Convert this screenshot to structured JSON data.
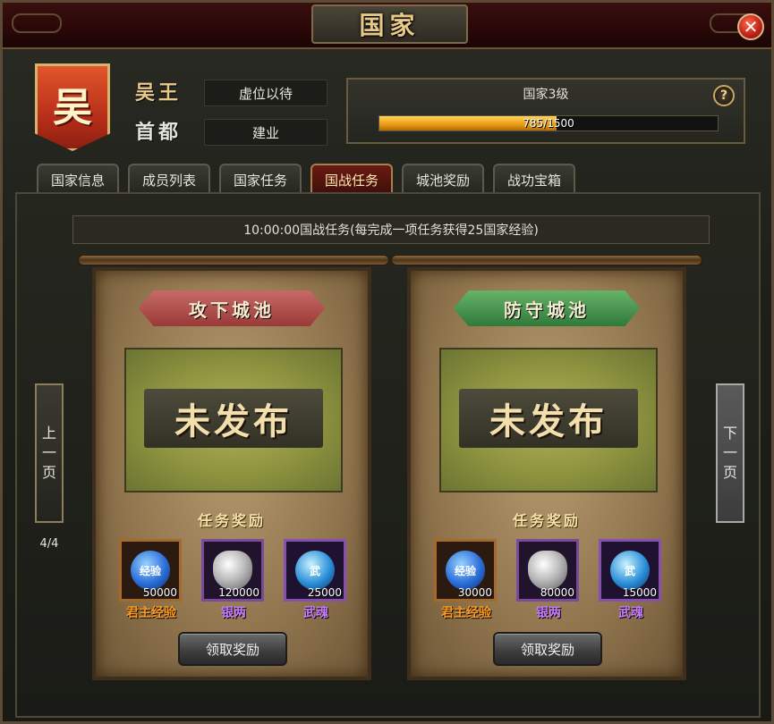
{
  "window": {
    "title": "国家",
    "close_symbol": "✕"
  },
  "header": {
    "banner_char": "吴",
    "rank_label": "吴王",
    "rank_value": "虚位以待",
    "capital_label": "首都",
    "capital_value": "建业",
    "level_text": "国家3级",
    "help_symbol": "?",
    "progress_text": "785/1500",
    "progress_fraction": 0.523
  },
  "tabs": [
    {
      "label": "国家信息",
      "active": false
    },
    {
      "label": "成员列表",
      "active": false
    },
    {
      "label": "国家任务",
      "active": false
    },
    {
      "label": "国战任务",
      "active": true
    },
    {
      "label": "城池奖励",
      "active": false
    },
    {
      "label": "战功宝箱",
      "active": false
    }
  ],
  "notice": "10:00:00国战任务(每完成一项任务获得25国家经验)",
  "pagination": {
    "prev_label": [
      "上",
      "一",
      "页"
    ],
    "next_label": [
      "下",
      "一",
      "页"
    ],
    "counter": "4/4"
  },
  "cards": [
    {
      "title": "攻下城池",
      "title_color": "red",
      "status": "未发布",
      "reward_title": "任务奖励",
      "rewards": [
        {
          "icon": "exp-orb-icon",
          "icon_text": "经验",
          "amount": "50000",
          "name": "君主经验",
          "name_color": "#ff9a1e"
        },
        {
          "icon": "silver-ingot-icon",
          "icon_text": "",
          "amount": "120000",
          "name": "银两",
          "name_color": "#c77aff"
        },
        {
          "icon": "martial-soul-icon",
          "icon_text": "武",
          "amount": "25000",
          "name": "武魂",
          "name_color": "#c77aff"
        }
      ],
      "claim_label": "领取奖励"
    },
    {
      "title": "防守城池",
      "title_color": "green",
      "status": "未发布",
      "reward_title": "任务奖励",
      "rewards": [
        {
          "icon": "exp-orb-icon",
          "icon_text": "经验",
          "amount": "30000",
          "name": "君主经验",
          "name_color": "#ff9a1e"
        },
        {
          "icon": "silver-ingot-icon",
          "icon_text": "",
          "amount": "80000",
          "name": "银两",
          "name_color": "#c77aff"
        },
        {
          "icon": "martial-soul-icon",
          "icon_text": "武",
          "amount": "15000",
          "name": "武魂",
          "name_color": "#c77aff"
        }
      ],
      "claim_label": "领取奖励"
    }
  ]
}
